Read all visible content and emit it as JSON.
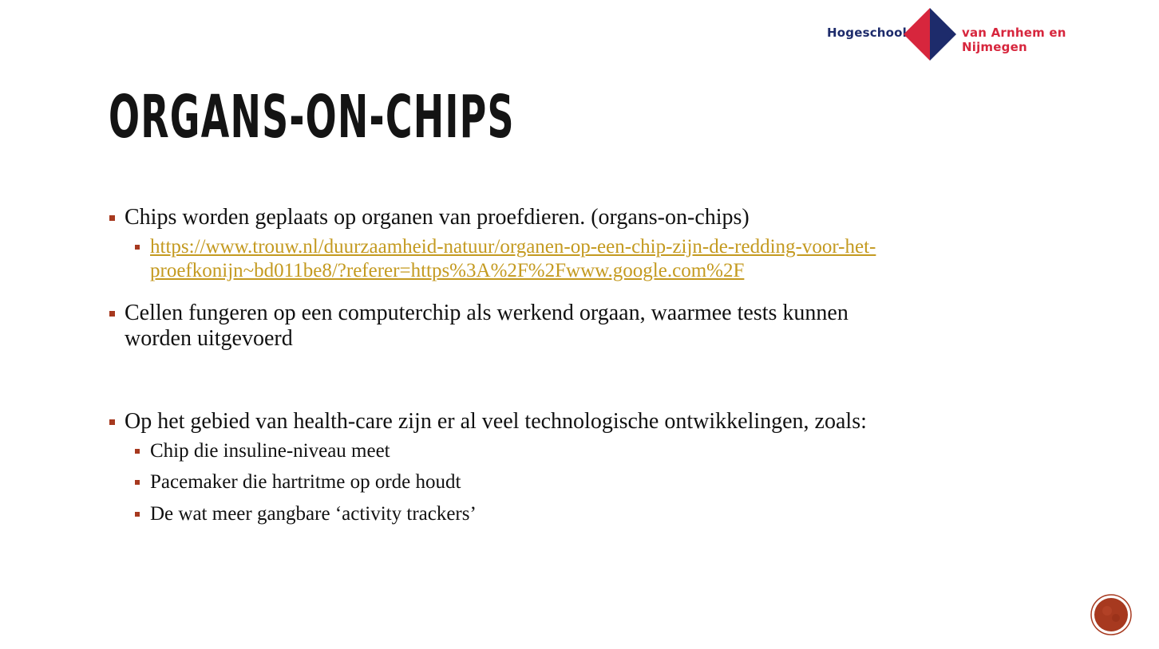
{
  "logo": {
    "left_text": "Hogeschool",
    "right_text": "van Arnhem en Nijmegen",
    "colors": {
      "navy": "#1d2b6b",
      "red": "#d7263d"
    }
  },
  "slide": {
    "title": "ORGANS-ON-CHIPS",
    "bullets": [
      {
        "text": "Chips worden geplaats op organen van proefdieren. (organs-on-chips)"
      },
      {
        "link_line1": "https://www.trouw.nl/duurzaamheid-natuur/organen-op-een-chip-zijn-de-redding-voor-het-",
        "link_line2": "proefkonijn~bd011be8/?referer=https%3A%2F%2Fwww.google.com%2F"
      },
      {
        "text_line1": "Cellen fungeren op een computerchip als werkend orgaan, waarmee tests kunnen",
        "text_line2": "worden uitgevoerd"
      },
      {
        "text": "Op het gebied van health-care zijn er al veel technologische ontwikkelingen, zoals:"
      },
      {
        "text": "Chip die insuline-niveau meet"
      },
      {
        "text": "Pacemaker die hartritme op orde houdt"
      },
      {
        "text": "De wat meer gangbare ‘activity trackers’"
      }
    ]
  },
  "accent_color": "#a7391f",
  "link_color": "#c49a20"
}
